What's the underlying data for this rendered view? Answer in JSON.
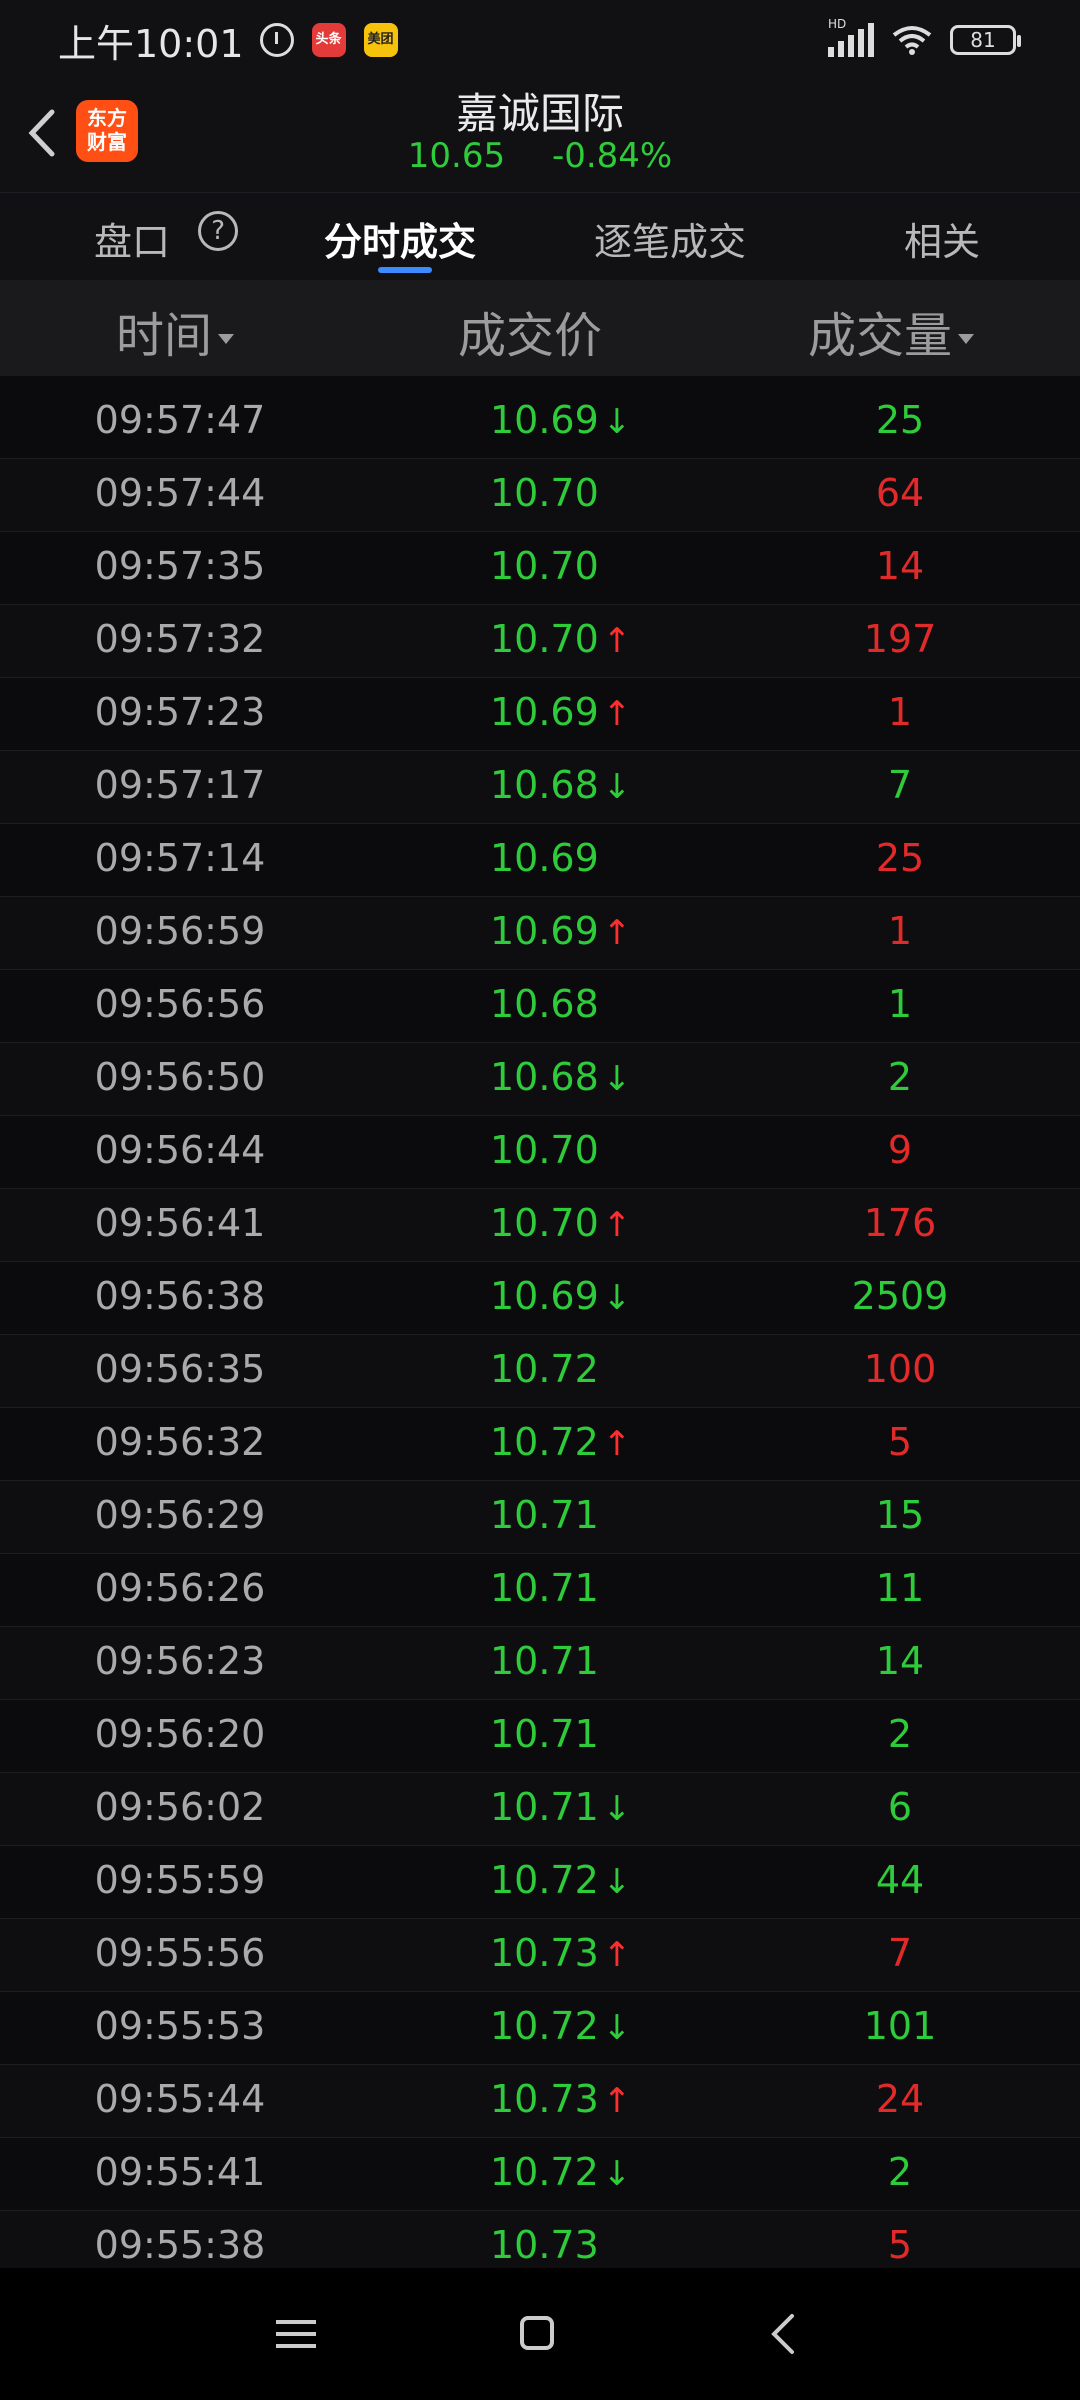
{
  "status_bar": {
    "time": "上午10:01",
    "badge_toutiao": "头条",
    "badge_meituan": "美团",
    "network": "HD",
    "battery": "81"
  },
  "header": {
    "stock_name": "嘉诚国际",
    "price": "10.65",
    "change_pct": "-0.84%",
    "brand_line1": "东方",
    "brand_line2": "财富"
  },
  "tabs": [
    {
      "label": "盘口"
    },
    {
      "label": "分时成交"
    },
    {
      "label": "逐笔成交"
    },
    {
      "label": "相关"
    }
  ],
  "columns": {
    "time": "时间",
    "price": "成交价",
    "volume": "成交量"
  },
  "colors": {
    "up": "#e22a2a",
    "down": "#2ecc3a",
    "accent": "#3c8bff",
    "brand": "#ff4f14"
  },
  "trades": [
    {
      "time": "09:57:47",
      "price": "10.69",
      "arrow": "down",
      "volume": "25",
      "vol_color": "green"
    },
    {
      "time": "09:57:44",
      "price": "10.70",
      "arrow": "",
      "volume": "64",
      "vol_color": "red"
    },
    {
      "time": "09:57:35",
      "price": "10.70",
      "arrow": "",
      "volume": "14",
      "vol_color": "red"
    },
    {
      "time": "09:57:32",
      "price": "10.70",
      "arrow": "up",
      "volume": "197",
      "vol_color": "red"
    },
    {
      "time": "09:57:23",
      "price": "10.69",
      "arrow": "up",
      "volume": "1",
      "vol_color": "red"
    },
    {
      "time": "09:57:17",
      "price": "10.68",
      "arrow": "down",
      "volume": "7",
      "vol_color": "green"
    },
    {
      "time": "09:57:14",
      "price": "10.69",
      "arrow": "",
      "volume": "25",
      "vol_color": "red"
    },
    {
      "time": "09:56:59",
      "price": "10.69",
      "arrow": "up",
      "volume": "1",
      "vol_color": "red"
    },
    {
      "time": "09:56:56",
      "price": "10.68",
      "arrow": "",
      "volume": "1",
      "vol_color": "green"
    },
    {
      "time": "09:56:50",
      "price": "10.68",
      "arrow": "down",
      "volume": "2",
      "vol_color": "green"
    },
    {
      "time": "09:56:44",
      "price": "10.70",
      "arrow": "",
      "volume": "9",
      "vol_color": "red"
    },
    {
      "time": "09:56:41",
      "price": "10.70",
      "arrow": "up",
      "volume": "176",
      "vol_color": "red"
    },
    {
      "time": "09:56:38",
      "price": "10.69",
      "arrow": "down",
      "volume": "2509",
      "vol_color": "green"
    },
    {
      "time": "09:56:35",
      "price": "10.72",
      "arrow": "",
      "volume": "100",
      "vol_color": "red"
    },
    {
      "time": "09:56:32",
      "price": "10.72",
      "arrow": "up",
      "volume": "5",
      "vol_color": "red"
    },
    {
      "time": "09:56:29",
      "price": "10.71",
      "arrow": "",
      "volume": "15",
      "vol_color": "green"
    },
    {
      "time": "09:56:26",
      "price": "10.71",
      "arrow": "",
      "volume": "11",
      "vol_color": "green"
    },
    {
      "time": "09:56:23",
      "price": "10.71",
      "arrow": "",
      "volume": "14",
      "vol_color": "green"
    },
    {
      "time": "09:56:20",
      "price": "10.71",
      "arrow": "",
      "volume": "2",
      "vol_color": "green"
    },
    {
      "time": "09:56:02",
      "price": "10.71",
      "arrow": "down",
      "volume": "6",
      "vol_color": "green"
    },
    {
      "time": "09:55:59",
      "price": "10.72",
      "arrow": "down",
      "volume": "44",
      "vol_color": "green"
    },
    {
      "time": "09:55:56",
      "price": "10.73",
      "arrow": "up",
      "volume": "7",
      "vol_color": "red"
    },
    {
      "time": "09:55:53",
      "price": "10.72",
      "arrow": "down",
      "volume": "101",
      "vol_color": "green"
    },
    {
      "time": "09:55:44",
      "price": "10.73",
      "arrow": "up",
      "volume": "24",
      "vol_color": "red"
    },
    {
      "time": "09:55:41",
      "price": "10.72",
      "arrow": "down",
      "volume": "2",
      "vol_color": "green"
    },
    {
      "time": "09:55:38",
      "price": "10.73",
      "arrow": "",
      "volume": "5",
      "vol_color": "red"
    }
  ]
}
